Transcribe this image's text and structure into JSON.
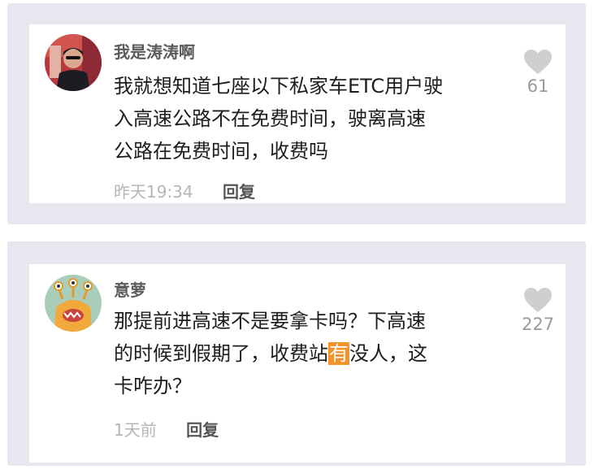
{
  "comments": [
    {
      "username": "我是涛涛啊",
      "text_lines": [
        "我就想知道七座以下私家车ETC用户驶",
        "入高速公路不在免费时间，驶离高速",
        "公路在免费时间，收费吗"
      ],
      "time": "昨天19:34",
      "reply_label": "回复",
      "like_count": "61",
      "avatar": "person-photo"
    },
    {
      "username": "意萝",
      "text_line1": "那提前进高速不是要拿卡吗？下高速",
      "text_line2_before": "的时候到假期了，收费站",
      "text_line2_highlight": "有",
      "text_line2_after": "没人，这",
      "text_line3": "卡咋办？",
      "time": "1天前",
      "reply_label": "回复",
      "like_count": "227",
      "avatar": "cartoon-monster"
    }
  ],
  "colors": {
    "panel_bg": "#e7e7ef",
    "card_bg": "#ffffff",
    "highlight": "#f5922a",
    "like_icon": "#cfcfcf"
  }
}
